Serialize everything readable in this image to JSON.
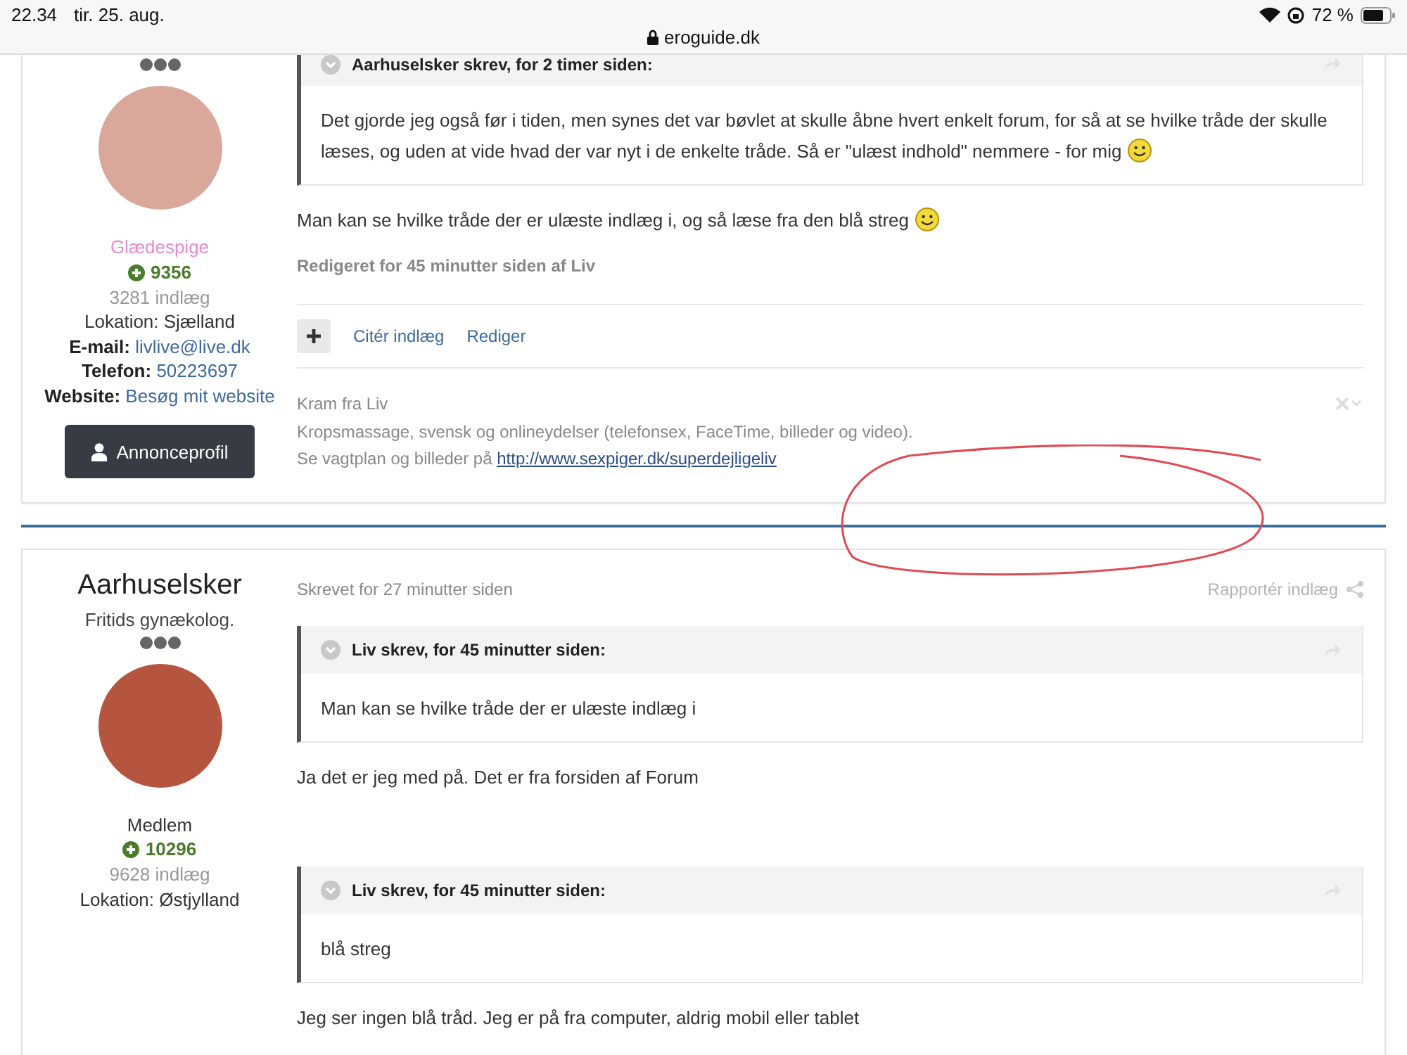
{
  "status_bar": {
    "time": "22.34",
    "date": "tir. 25. aug.",
    "url": "eroguide.dk",
    "battery": "72 %"
  },
  "posts": [
    {
      "rank": "Glædespige",
      "color": "#e58bd0",
      "reputation": "9356",
      "posts_count": "3281 indlæg",
      "location": "Lokation: Sjælland",
      "fields": [
        {
          "label": "E-mail:",
          "value": "livlive@live.dk"
        },
        {
          "label": "Telefon:",
          "value": "50223697"
        },
        {
          "label": "Website:",
          "value": "Besøg mit website"
        }
      ],
      "profile_button": "Annonceprofil",
      "blocks": [
        {
          "kind": "quote",
          "header": "Aarhuselsker skrev, for 2 timer siden:",
          "body": "Det gjorde jeg også før i tiden, men synes det var bøvlet at skulle åbne hvert enkelt forum, for så at se hvilke tråde der skulle læses, og uden at vide hvad der var nyt i de enkelte tråde. Så er \"ulæst indhold\" nemmere - for mig",
          "smiley": true
        },
        {
          "kind": "paragraph",
          "text": "Man kan se hvilke tråde der er ulæste indlæg i, og så læse fra den blå streg",
          "smiley": true
        },
        {
          "kind": "edited",
          "text": "Redigeret for 45 minutter siden af Liv"
        }
      ],
      "actions": [
        "Citér indlæg",
        "Rediger"
      ],
      "signature": {
        "lines": [
          "Kram fra Liv",
          "Kropsmassage, svensk og onlineydelser (telefonsex, FaceTime, billeder og video)."
        ],
        "link_prefix": "Se vagtplan og billeder på",
        "link": "http://www.sexpiger.dk/superdejligeliv"
      }
    },
    {
      "author": "Aarhuselsker",
      "title": "Fritids gynækolog.",
      "rank": "Medlem",
      "color": "#333333",
      "reputation": "10296",
      "posts_count": "9628 indlæg",
      "location": "Lokation: Østjylland",
      "meta": "Skrevet for 27 minutter siden",
      "report": "Rapportér indlæg",
      "blocks": [
        {
          "kind": "quote",
          "header": "Liv skrev, for 45 minutter siden:",
          "body": "Man kan se hvilke tråde der er ulæste indlæg i"
        },
        {
          "kind": "paragraph",
          "text": "Ja det er jeg med på. Det er fra forsiden af Forum"
        },
        {
          "kind": "spacer"
        },
        {
          "kind": "quote",
          "header": "Liv skrev, for 45 minutter siden:",
          "body": "blå streg"
        },
        {
          "kind": "paragraph",
          "text": "Jeg ser ingen blå tråd. Jeg er på fra computer, aldrig mobil eller tablet"
        }
      ]
    }
  ]
}
